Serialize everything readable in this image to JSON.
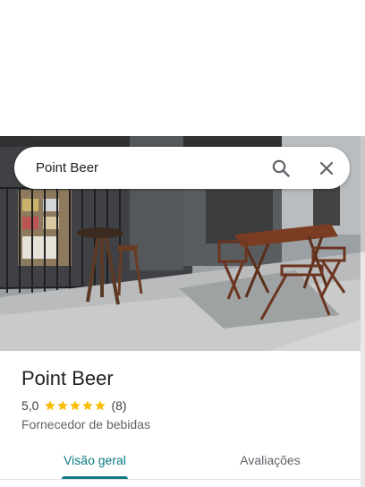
{
  "search": {
    "query": "Point Beer",
    "search_icon": "search-icon",
    "close_icon": "close-icon"
  },
  "place": {
    "name": "Point Beer",
    "rating_value": "5,0",
    "rating_stars": 5,
    "review_count": "(8)",
    "category": "Fornecedor de bebidas"
  },
  "tabs": [
    {
      "label": "Visão geral",
      "active": true
    },
    {
      "label": "Avaliações",
      "active": false
    }
  ],
  "colors": {
    "accent": "#0b7a83",
    "star": "#fbbc04"
  }
}
